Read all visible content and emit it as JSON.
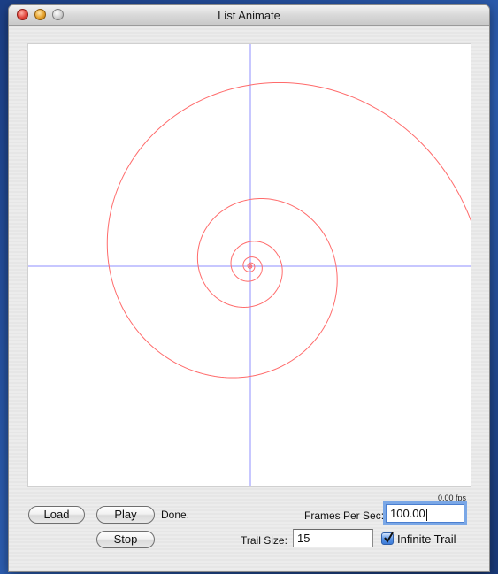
{
  "window": {
    "title": "List Animate",
    "controls": [
      "close",
      "minimize",
      "zoom"
    ]
  },
  "canvas": {
    "axes_color": "#8f8fff",
    "spiral_color": "#ff6b6b",
    "marker_color": "#000000"
  },
  "status": {
    "fps_readout": "0.00 fps",
    "state_text": "Done."
  },
  "buttons": {
    "load": "Load",
    "play": "Play",
    "stop": "Stop"
  },
  "fields": {
    "frames_per_sec_label": "Frames Per Sec:",
    "frames_per_sec_value": "100.00",
    "trail_size_label": "Trail Size:",
    "trail_size_value": "15"
  },
  "infinite_trail": {
    "label": "Infinite Trail",
    "checked": true
  }
}
